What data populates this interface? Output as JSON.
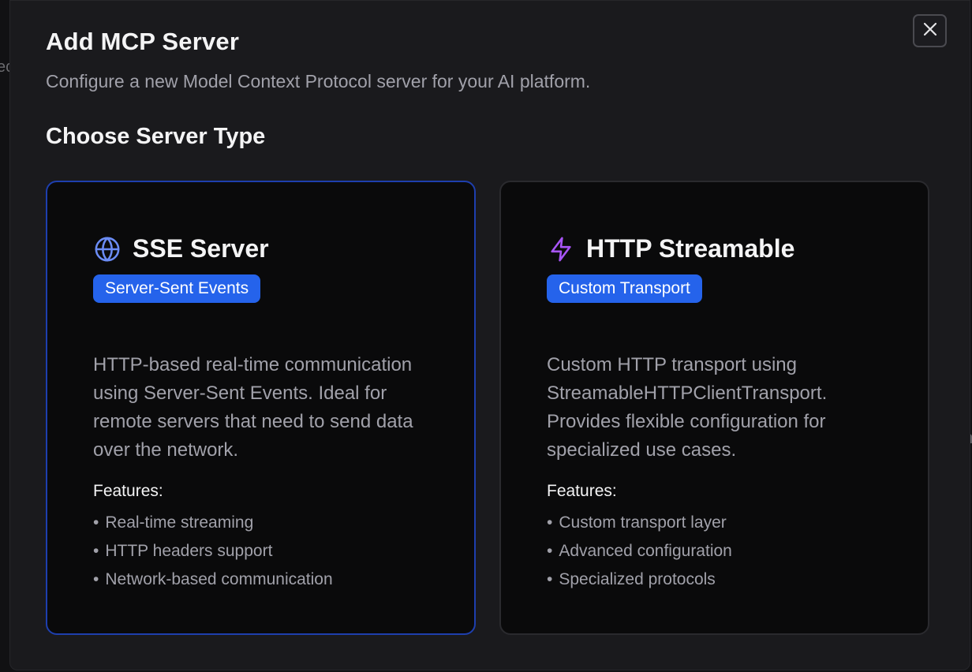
{
  "background": {
    "left_fragment": "ec",
    "right_fragment": "n"
  },
  "dialog": {
    "title": "Add MCP Server",
    "subtitle": "Configure a new Model Context Protocol server for your AI platform.",
    "close_icon": "close-icon",
    "section_title": "Choose Server Type"
  },
  "cards": [
    {
      "icon": "globe-icon",
      "icon_color": "#6b8cf5",
      "title": "SSE Server",
      "badge": "Server-Sent Events",
      "description": "HTTP-based real-time communication using Server-Sent Events. Ideal for remote servers that need to send data over the network.",
      "features_label": "Features:",
      "features": [
        "Real-time streaming",
        "HTTP headers support",
        "Network-based communication"
      ],
      "bullet": "•",
      "selected": true
    },
    {
      "icon": "lightning-icon",
      "icon_color": "#a855f7",
      "title": "HTTP Streamable",
      "badge": "Custom Transport",
      "description": "Custom HTTP transport using StreamableHTTPClientTransport. Provides flexible configuration for specialized use cases.",
      "features_label": "Features:",
      "features": [
        "Custom transport layer",
        "Advanced configuration",
        "Specialized protocols"
      ],
      "bullet": "•",
      "selected": false
    }
  ],
  "colors": {
    "accent": "#2563eb",
    "selected_border": "#1e3fae",
    "dialog_bg": "#1a1a1d",
    "card_bg": "#0a0a0b"
  }
}
